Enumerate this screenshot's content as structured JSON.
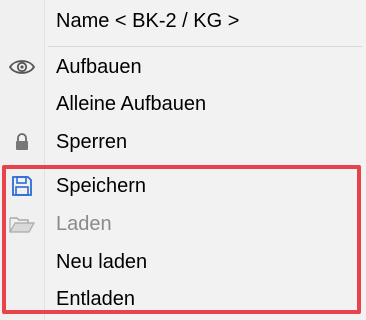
{
  "menu": {
    "header": "Name < BK-2 / KG >",
    "items": [
      {
        "label": "Aufbauen",
        "icon": "eye-icon",
        "enabled": true
      },
      {
        "label": "Alleine Aufbauen",
        "icon": "",
        "enabled": true
      },
      {
        "label": "Sperren",
        "icon": "lock-icon",
        "enabled": true
      },
      {
        "label": "Speichern",
        "icon": "save-icon",
        "enabled": true
      },
      {
        "label": "Laden",
        "icon": "open-folder-icon",
        "enabled": false
      },
      {
        "label": "Neu laden",
        "icon": "",
        "enabled": true
      },
      {
        "label": "Entladen",
        "icon": "",
        "enabled": true
      }
    ]
  },
  "colors": {
    "highlight_border": "#e8424a",
    "save_icon": "#2b6cd6",
    "disabled_text": "#8a8a8a"
  }
}
